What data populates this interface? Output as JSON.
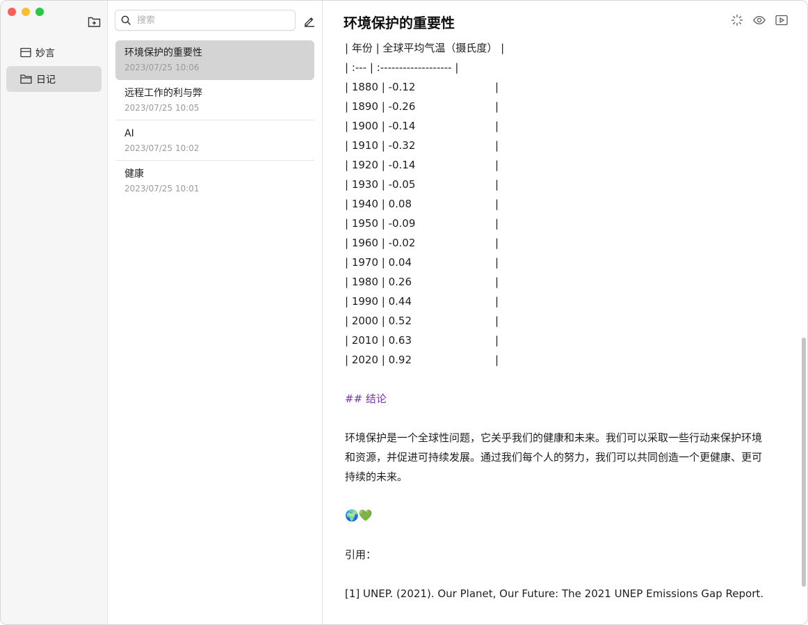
{
  "sidebar": {
    "folders": [
      {
        "label": "妙言",
        "icon": "inbox-icon",
        "active": false
      },
      {
        "label": "日记",
        "icon": "folder-icon",
        "active": true
      }
    ]
  },
  "notelist": {
    "search_placeholder": "搜索",
    "notes": [
      {
        "title": "环境保护的重要性",
        "date": "2023/07/25 10:06",
        "active": true
      },
      {
        "title": "远程工作的利与弊",
        "date": "2023/07/25 10:05",
        "active": false
      },
      {
        "title": "AI",
        "date": "2023/07/25 10:02",
        "active": false
      },
      {
        "title": "健康",
        "date": "2023/07/25 10:01",
        "active": false
      }
    ]
  },
  "editor": {
    "title": "环境保护的重要性",
    "table_header": "| 年份 | 全球平均气温（摄氏度） |",
    "table_separator": "| :--- | :------------------- |",
    "table_rows": [
      {
        "left": "| 1880 | -0.12",
        "right": "|"
      },
      {
        "left": "| 1890 | -0.26",
        "right": "|"
      },
      {
        "left": "| 1900 | -0.14",
        "right": "|"
      },
      {
        "left": "| 1910 | -0.32",
        "right": "|"
      },
      {
        "left": "| 1920 | -0.14",
        "right": "|"
      },
      {
        "left": "| 1930 | -0.05",
        "right": "|"
      },
      {
        "left": "| 1940 | 0.08",
        "right": "|"
      },
      {
        "left": "| 1950 | -0.09",
        "right": "|"
      },
      {
        "left": "| 1960 | -0.02",
        "right": "|"
      },
      {
        "left": "| 1970 | 0.04",
        "right": "|"
      },
      {
        "left": "| 1980 | 0.26",
        "right": "|"
      },
      {
        "left": "| 1990 | 0.44",
        "right": "|"
      },
      {
        "left": "| 2000 | 0.52",
        "right": "|"
      },
      {
        "left": "| 2010 | 0.63",
        "right": "|"
      },
      {
        "left": "| 2020 | 0.92",
        "right": "|"
      }
    ],
    "heading": "## 结论",
    "paragraph": "环境保护是一个全球性问题，它关乎我们的健康和未来。我们可以采取一些行动来保护环境和资源，并促进可持续发展。通过我们每个人的努力，我们可以共同创造一个更健康、更可持续的未来。",
    "emoji": "🌍💚",
    "citation_label": "引用：",
    "reference": "[1] UNEP. (2021). Our Planet, Our Future: The 2021 UNEP Emissions Gap Report."
  }
}
